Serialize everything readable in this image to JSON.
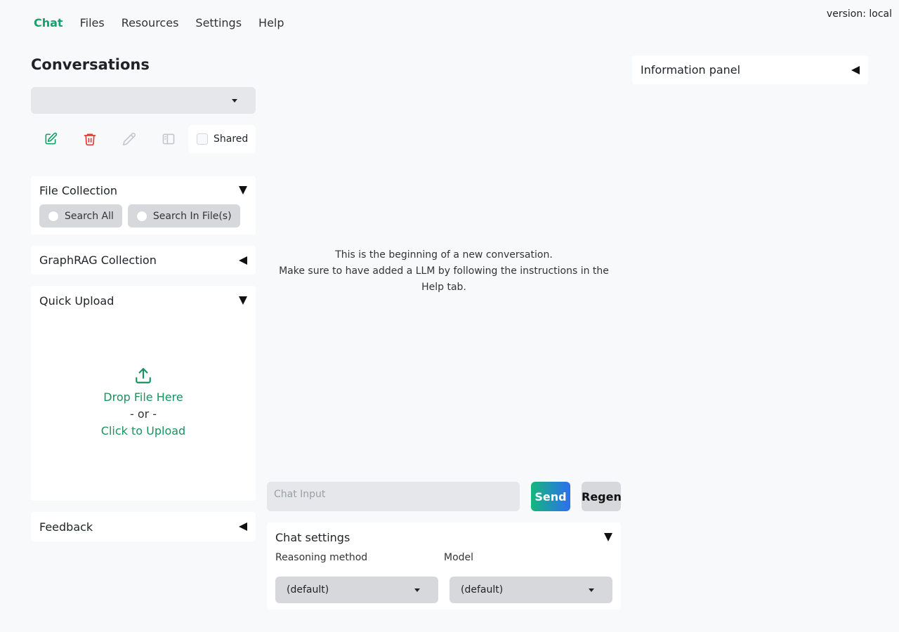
{
  "version_text": "version: local",
  "nav": {
    "tabs": [
      {
        "label": "Chat"
      },
      {
        "label": "Files"
      },
      {
        "label": "Resources"
      },
      {
        "label": "Settings"
      },
      {
        "label": "Help"
      }
    ],
    "active": "Chat"
  },
  "conversations": {
    "title": "Conversations",
    "selected": "",
    "shared_label": "Shared",
    "shared_checked": false
  },
  "file_collection": {
    "title": "File Collection",
    "options": [
      {
        "label": "Search All"
      },
      {
        "label": "Search In File(s)"
      }
    ]
  },
  "graphrag_collection": {
    "title": "GraphRAG Collection"
  },
  "quick_upload": {
    "title": "Quick Upload",
    "drop_text": "Drop File Here",
    "or_text": "- or -",
    "click_text": "Click to Upload"
  },
  "feedback": {
    "title": "Feedback"
  },
  "chat": {
    "message_line1": "This is the beginning of a new conversation.",
    "message_line2": "Make sure to have added a LLM by following the instructions in the Help tab.",
    "input_placeholder": "Chat Input",
    "send_label": "Send",
    "regen_label": "Regen"
  },
  "chat_settings": {
    "title": "Chat settings",
    "reasoning_label": "Reasoning method",
    "reasoning_value": "(default)",
    "model_label": "Model",
    "model_value": "(default)"
  },
  "info_panel": {
    "title": "Information panel"
  },
  "colors": {
    "accent": "#17a26b",
    "danger": "#e53935",
    "send_gradient_start": "#16b67c",
    "send_gradient_end": "#2c6ff0"
  },
  "icons": {
    "new": "new-conversation-icon",
    "delete": "delete-icon",
    "rename": "rename-icon",
    "toggle_sidebar": "sidebar-toggle-icon",
    "upload": "upload-icon"
  }
}
